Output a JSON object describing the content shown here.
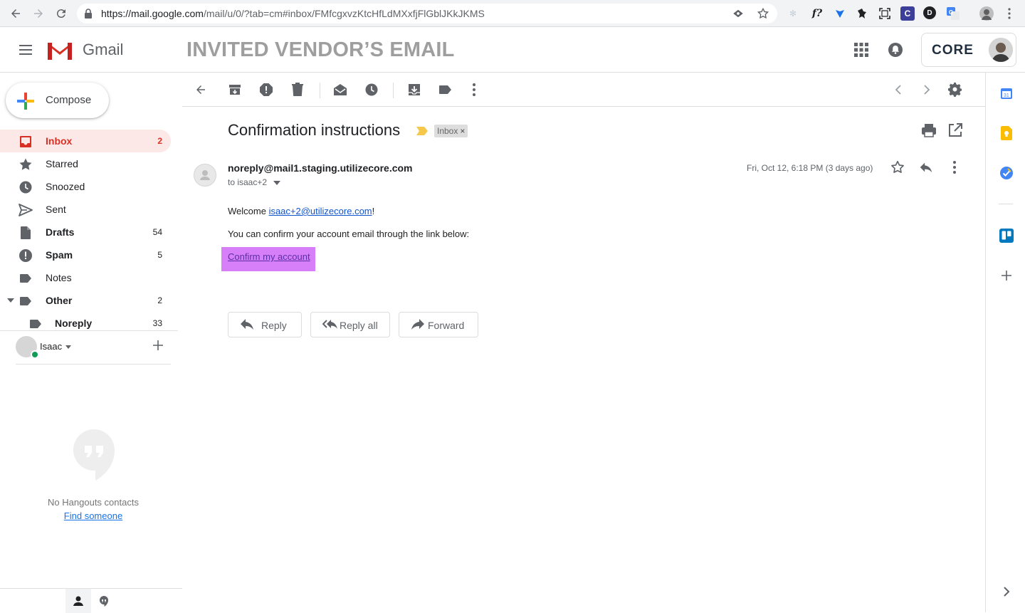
{
  "browser": {
    "url_host": "https://mail.google.com",
    "url_path": "/mail/u/0/?tab=cm#inbox/FMfcgxvzKtcHfLdMXxfjFlGblJKkJKMS",
    "ext_f_label": "f?",
    "ext_c_label": "C",
    "ext_d_label": "D"
  },
  "header": {
    "app_name": "Gmail",
    "overlay_title": "INVITED VENDOR’S EMAIL",
    "account_logo": "CORE"
  },
  "compose": {
    "label": "Compose"
  },
  "nav": [
    {
      "label": "Inbox",
      "count": "2",
      "icon": "inbox-icon"
    },
    {
      "label": "Starred",
      "count": "",
      "icon": "star-icon"
    },
    {
      "label": "Snoozed",
      "count": "",
      "icon": "clock-icon"
    },
    {
      "label": "Sent",
      "count": "",
      "icon": "send-icon"
    },
    {
      "label": "Drafts",
      "count": "54",
      "icon": "draft-icon"
    },
    {
      "label": "Spam",
      "count": "5",
      "icon": "spam-icon"
    },
    {
      "label": "Notes",
      "count": "",
      "icon": "label-icon"
    },
    {
      "label": "Other",
      "count": "2",
      "icon": "label-icon"
    },
    {
      "label": "Noreply",
      "count": "33",
      "icon": "label-icon"
    }
  ],
  "hangouts": {
    "user_name": "Isaac",
    "empty_text": "No Hangouts contacts",
    "find_link": "Find someone"
  },
  "message": {
    "subject": "Confirmation instructions",
    "label_chip": "Inbox",
    "label_chip_remove": "×",
    "sender": "noreply@mail1.staging.utilizecore.com",
    "recipients": "to isaac+2",
    "date": "Fri, Oct 12, 6:18 PM (3 days ago)",
    "welcome_prefix": "Welcome ",
    "welcome_email": "isaac+2@utilizecore.com",
    "welcome_suffix": "!",
    "confirm_text": "You can confirm your account email through the link below:",
    "confirm_link": "Confirm my account",
    "highlight_color": "#d67ff8"
  },
  "actions": {
    "reply": "Reply",
    "reply_all": "Reply all",
    "forward": "Forward"
  },
  "colors": {
    "gmail_red": "#d93025",
    "active_bg": "#fce8e6",
    "link_blue": "#1155cc"
  }
}
